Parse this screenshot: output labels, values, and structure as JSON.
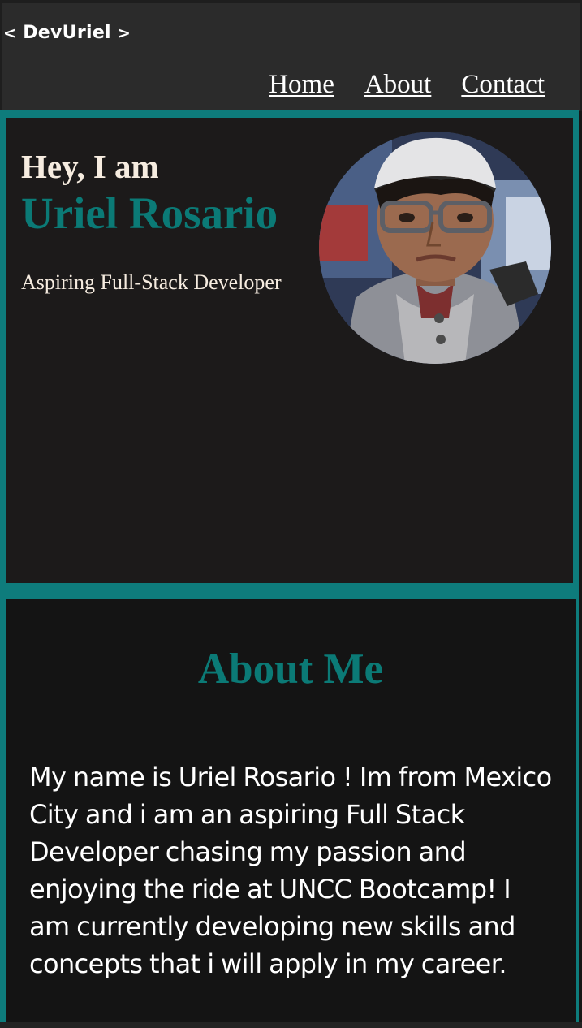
{
  "header": {
    "brand_open": "<",
    "brand_name": "DevUriel",
    "brand_close": ">",
    "nav": [
      {
        "label": "Home"
      },
      {
        "label": "About"
      },
      {
        "label": "Contact"
      }
    ]
  },
  "hero": {
    "greeting": "Hey, I am",
    "name": "Uriel Rosario",
    "subtitle": "Aspiring Full-Stack Developer",
    "avatar_icon": "profile-photo"
  },
  "about": {
    "title": "About Me",
    "body": "My name is Uriel Rosario ! Im from Mexico City and i am an aspiring Full Stack Developer chasing my passion and enjoying the ride at UNCC Bootcamp! I am currently developing new skills and concepts that i will apply in my career."
  },
  "colors": {
    "accent": "#0e7c7c",
    "heading_teal": "#0b7a76",
    "header_bg": "#2b2b2b",
    "hero_bg": "#1c1a1a",
    "about_bg": "#141414",
    "text_light": "#f6ece0"
  }
}
